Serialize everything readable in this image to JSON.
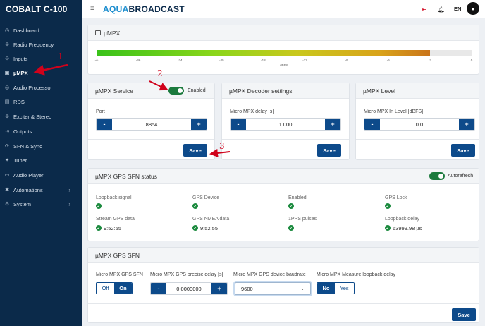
{
  "app": {
    "brand": "COBALT C-100",
    "logo_part1": "AQUA",
    "logo_part2": "BROADCAST",
    "language": "EN"
  },
  "sidebar": {
    "items": [
      {
        "label": "Dashboard",
        "icon": "dashboard-icon"
      },
      {
        "label": "Radio Frequency",
        "icon": "radio-icon"
      },
      {
        "label": "Inputs",
        "icon": "inputs-icon"
      },
      {
        "label": "µMPX",
        "icon": "umpx-icon",
        "active": true
      },
      {
        "label": "Audio Processor",
        "icon": "audio-processor-icon"
      },
      {
        "label": "RDS",
        "icon": "rds-icon"
      },
      {
        "label": "Exciter & Stereo",
        "icon": "exciter-icon"
      },
      {
        "label": "Outputs",
        "icon": "outputs-icon"
      },
      {
        "label": "SFN & Sync",
        "icon": "sync-icon"
      },
      {
        "label": "Tuner",
        "icon": "tuner-icon"
      },
      {
        "label": "Audio Player",
        "icon": "audio-player-icon"
      },
      {
        "label": "Automations",
        "icon": "automations-icon",
        "chevron": "›"
      },
      {
        "label": "System",
        "icon": "system-icon",
        "chevron": "›"
      }
    ]
  },
  "meter": {
    "title": "µMPX",
    "level_fraction": 0.889,
    "ticks": [
      "-∞",
      "-46",
      "-34",
      "-25",
      "-18",
      "-12",
      "-9",
      "-6",
      "-3",
      "0"
    ],
    "unit": "dBFS"
  },
  "service": {
    "title": "µMPX Service",
    "enabled_label": "Enabled",
    "port_label": "Port",
    "port_value": "8854",
    "minus": "-",
    "plus": "+",
    "save": "Save"
  },
  "decoder": {
    "title": "µMPX Decoder settings",
    "delay_label": "Micro MPX delay [s]",
    "delay_value": "1.000",
    "save": "Save"
  },
  "level": {
    "title": "µMPX Level",
    "in_level_label": "Micro MPX In Level [dBFS]",
    "in_level_value": "0.0",
    "save": "Save"
  },
  "gps_status": {
    "title": "µMPX GPS SFN status",
    "autorefresh_label": "Autorefresh",
    "row1": [
      "Loopback signal",
      "GPS Device",
      "Enabled",
      "GPS Lock"
    ],
    "row2_labels": [
      "Stream GPS data",
      "GPS NMEA data",
      "1PPS pulses",
      "Loopback delay"
    ],
    "row2_values": [
      "9:52:55",
      "9:52:55",
      "",
      "63999.98 µs"
    ]
  },
  "gps_sfn": {
    "title": "µMPX GPS SFN",
    "sfn_label": "Micro MPX GPS SFN",
    "sfn_off": "Off",
    "sfn_on": "On",
    "delay_label": "Micro MPX GPS precise delay [s]",
    "delay_value": "0.0000000",
    "baud_label": "Micro MPX GPS device baudrate",
    "baud_value": "9600",
    "loop_label": "Micro MPX Measure loopback delay",
    "loop_no": "No",
    "loop_yes": "Yes",
    "save": "Save"
  },
  "annotations": [
    "1",
    "2",
    "3"
  ],
  "colors": {
    "sidebar_bg": "#0b2a4a",
    "primary": "#0d4a8a",
    "success": "#1b8a3e",
    "annotation": "#d0021b"
  }
}
